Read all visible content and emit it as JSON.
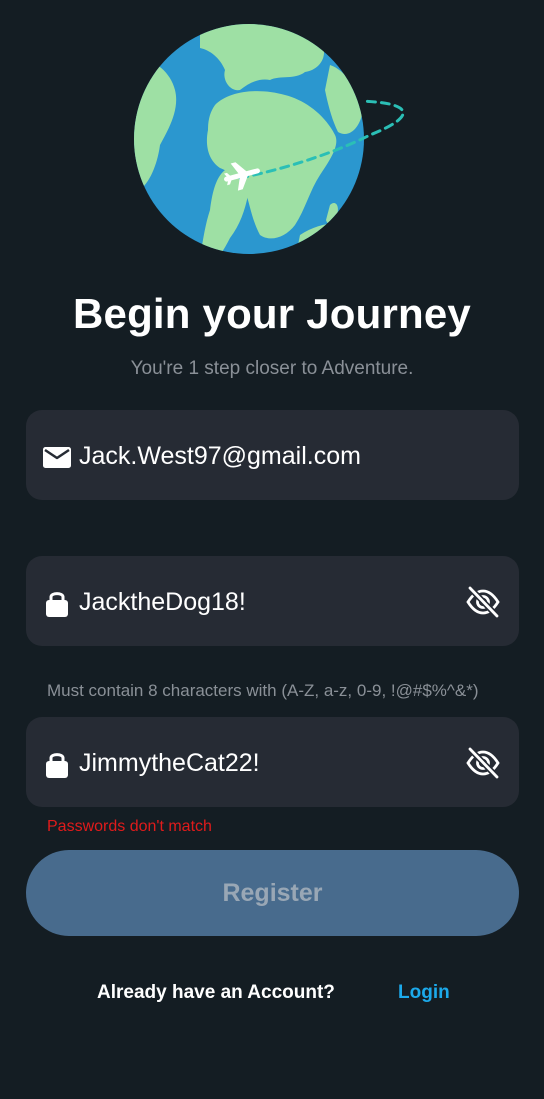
{
  "header": {
    "title": "Begin your Journey",
    "subtitle": "You're 1 step closer to Adventure."
  },
  "email_field": {
    "icon": "mail-icon",
    "value": "Jack.West97@gmail.com"
  },
  "password_field": {
    "icon": "lock-icon",
    "value": "JacktheDog18!",
    "toggle_icon": "eye-off-icon"
  },
  "password_hint": "Must contain 8 characters with (A-Z, a-z, 0-9, !@#$%^&*)",
  "confirm_field": {
    "icon": "lock-icon",
    "value": "JimmytheCat22!",
    "toggle_icon": "eye-off-icon"
  },
  "error_message": "Passwords don't match",
  "register_button": {
    "label": "Register"
  },
  "footer": {
    "question": "Already have an Account?",
    "link": "Login"
  },
  "colors": {
    "background": "#141d23",
    "field_background": "#262b34",
    "button_disabled": "#486b8d",
    "link": "#1ca9ea",
    "error": "#e01b1b",
    "globe_ocean": "#2b97cf",
    "globe_land": "#9ee0a4",
    "flight_path": "#2bbfb6"
  }
}
